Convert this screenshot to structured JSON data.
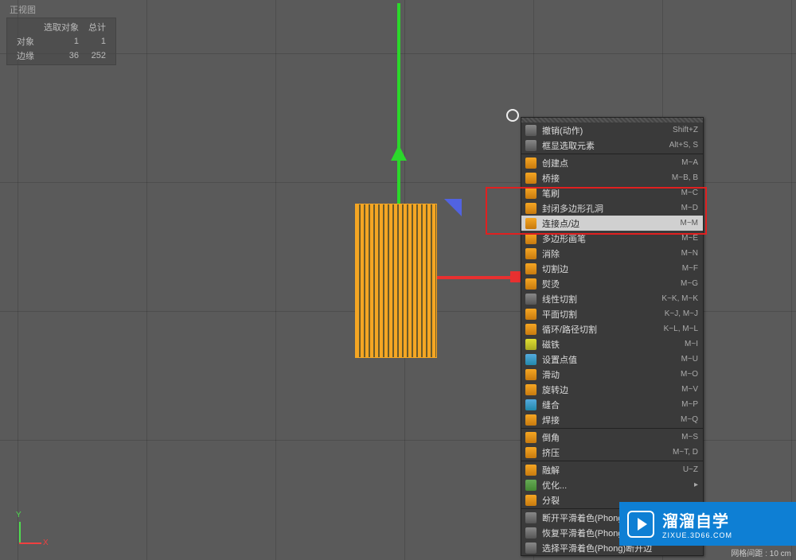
{
  "viewLabel": "正视图",
  "stats": {
    "header_sel": "选取对象",
    "header_total": "总计",
    "row1_label": "对象",
    "row1_sel": "1",
    "row1_total": "1",
    "row2_label": "边缘",
    "row2_sel": "36",
    "row2_total": "252"
  },
  "axis": {
    "x": "X",
    "y": "Y"
  },
  "menu": {
    "items": [
      {
        "icon": "grey",
        "label": "撤销(动作)",
        "shortcut": "Shift+Z"
      },
      {
        "icon": "grey",
        "label": "框显选取元素",
        "shortcut": "Alt+S, S"
      },
      {
        "divider": true
      },
      {
        "icon": "orange",
        "label": "创建点",
        "shortcut": "M~A"
      },
      {
        "icon": "orange",
        "label": "桥接",
        "shortcut": "M~B, B"
      },
      {
        "icon": "orange",
        "label": "笔刷",
        "shortcut": "M~C"
      },
      {
        "icon": "orange",
        "label": "封闭多边形孔洞",
        "shortcut": "M~D"
      },
      {
        "icon": "orange",
        "label": "连接点/边",
        "shortcut": "M~M",
        "highlighted": true
      },
      {
        "icon": "orange",
        "label": "多边形画笔",
        "shortcut": "M~E"
      },
      {
        "icon": "orange",
        "label": "消除",
        "shortcut": "M~N"
      },
      {
        "icon": "orange",
        "label": "切割边",
        "shortcut": "M~F"
      },
      {
        "icon": "orange",
        "label": "熨烫",
        "shortcut": "M~G"
      },
      {
        "icon": "grey",
        "label": "线性切割",
        "shortcut": "K~K, M~K"
      },
      {
        "icon": "orange",
        "label": "平面切割",
        "shortcut": "K~J, M~J"
      },
      {
        "icon": "orange",
        "label": "循环/路径切割",
        "shortcut": "K~L, M~L"
      },
      {
        "icon": "yellow",
        "label": "磁铁",
        "shortcut": "M~I"
      },
      {
        "icon": "blue",
        "label": "设置点值",
        "shortcut": "M~U"
      },
      {
        "icon": "orange",
        "label": "滑动",
        "shortcut": "M~O"
      },
      {
        "icon": "orange",
        "label": "旋转边",
        "shortcut": "M~V"
      },
      {
        "icon": "blue",
        "label": "缝合",
        "shortcut": "M~P"
      },
      {
        "icon": "orange",
        "label": "焊接",
        "shortcut": "M~Q"
      },
      {
        "divider": true
      },
      {
        "icon": "orange",
        "label": "倒角",
        "shortcut": "M~S"
      },
      {
        "icon": "orange",
        "label": "挤压",
        "shortcut": "M~T, D"
      },
      {
        "divider": true
      },
      {
        "icon": "orange",
        "label": "融解",
        "shortcut": "U~Z"
      },
      {
        "icon": "green",
        "label": "优化...",
        "submenu": true
      },
      {
        "icon": "orange",
        "label": "分裂",
        "shortcut": ""
      },
      {
        "divider": true
      },
      {
        "icon": "grey",
        "label": "断开平滑着色(Phong)",
        "shortcut": ""
      },
      {
        "icon": "grey",
        "label": "恢复平滑着色(Phong)",
        "shortcut": ""
      },
      {
        "icon": "grey",
        "label": "选择平滑着色(Phong)断开边",
        "shortcut": ""
      }
    ]
  },
  "watermark": {
    "cn": "溜溜自学",
    "en": "ZIXUE.3D66.COM"
  },
  "status": {
    "grid_label": "网格间距 :",
    "grid_value": "10 cm"
  }
}
